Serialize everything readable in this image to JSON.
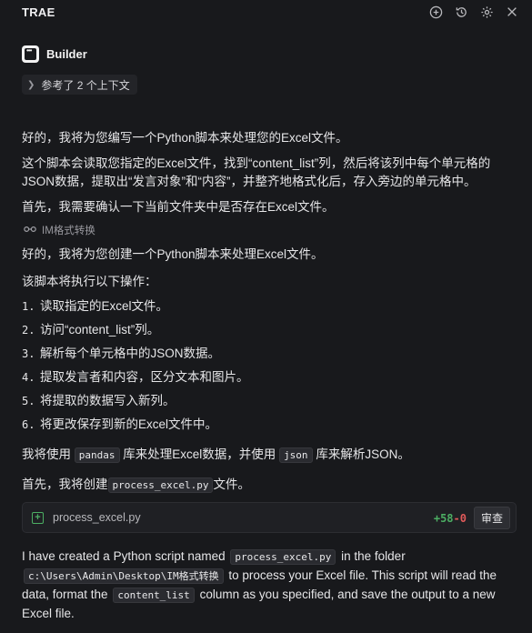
{
  "header": {
    "title": "TRAE",
    "icons": [
      "new-chat-icon",
      "history-icon",
      "settings-icon",
      "close-icon"
    ]
  },
  "agent": {
    "name": "Builder"
  },
  "context_chip": {
    "label": "参考了 2 个上下文"
  },
  "messages": {
    "p1": "好的，我将为您编写一个Python脚本来处理您的Excel文件。",
    "p2": "这个脚本会读取您指定的Excel文件，找到“content_list”列，然后将该列中每个单元格的JSON数据，提取出“发言对象”和“内容”，并整齐地格式化后，存入旁边的单元格中。",
    "p3": "首先，我需要确认一下当前文件夹中是否存在Excel文件。",
    "tool_label": "IM格式转换",
    "p4": "好的，我将为您创建一个Python脚本来处理Excel文件。",
    "p5": "该脚本将执行以下操作：",
    "steps": [
      {
        "num": "1.",
        "text": "读取指定的Excel文件。"
      },
      {
        "num": "2.",
        "text": "访问“content_list”列。"
      },
      {
        "num": "3.",
        "text": "解析每个单元格中的JSON数据。"
      },
      {
        "num": "4.",
        "text": "提取发言者和内容，区分文本和图片。"
      },
      {
        "num": "5.",
        "text": "将提取的数据写入新列。"
      },
      {
        "num": "6.",
        "text": "将更改保存到新的Excel文件中。"
      }
    ],
    "p6a": "我将使用",
    "p6_code1": "pandas",
    "p6b": "库来处理Excel数据，并使用",
    "p6_code2": "json",
    "p6c": "库来解析JSON。",
    "p7a": "首先，我将创建",
    "p7_code": "process_excel.py",
    "p7b": "文件。"
  },
  "file_card": {
    "filename": "process_excel.py",
    "added": "+58",
    "removed": "-0",
    "review_label": "审查"
  },
  "final": {
    "t1": "I have created a Python script named",
    "c1": "process_excel.py",
    "t2": "in the folder",
    "c2": "c:\\Users\\Admin\\Desktop\\IM格式转换",
    "t3": "to process your Excel file. This script will read the data, format the",
    "c3": "content_list",
    "t4": "column as you specified, and save the output to a new Excel file."
  }
}
